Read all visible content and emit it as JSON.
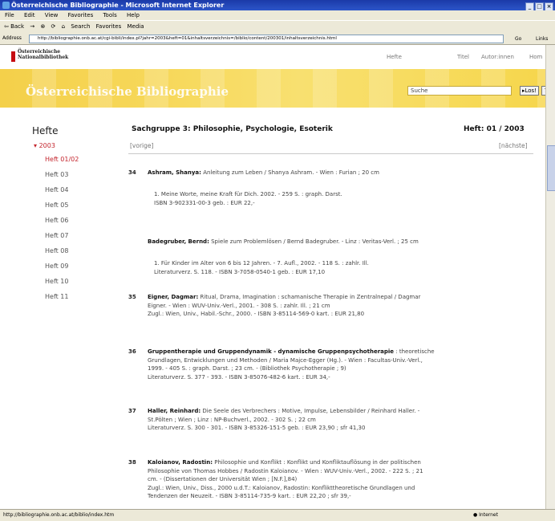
{
  "window": {
    "title": "Österreichische Bibliographie - Microsoft Internet Explorer",
    "controls": [
      "_",
      "□",
      "×"
    ]
  },
  "menu": [
    "File",
    "Edit",
    "View",
    "Favorites",
    "Tools",
    "Help"
  ],
  "toolbar": {
    "back": "⇦ Back",
    "forward": "→",
    "search": "Search",
    "favorites": "Favorites",
    "media": "Media"
  },
  "address": {
    "label": "Address",
    "url": "http://bibliographie.onb.ac.at/cgi-bibli/index.pl?jahr=2003&heft=01&inhaltsverzeichnis=/biblio/content/200301/inhaltsverzeichnis.html",
    "go": "Go",
    "links": "Links"
  },
  "site": {
    "logo_line1": "Österreichische",
    "logo_line2": "Nationalbibliothek",
    "nav": [
      "Hefte",
      "Titel",
      "Autor:innen",
      "Hom"
    ],
    "banner_title": "Österreichische Bibliographie",
    "search_value": "Suche",
    "search_button": "Los!",
    "help_button": "?"
  },
  "sidebar": {
    "title": "Hefte",
    "year": "2003",
    "items": [
      "Heft 01/02",
      "Heft 03",
      "Heft 04",
      "Heft 05",
      "Heft 06",
      "Heft 07",
      "Heft 08",
      "Heft 09",
      "Heft 10",
      "Heft 11"
    ],
    "active": "Heft 01/02"
  },
  "content": {
    "heading": "Sachgruppe 3: Philosophie, Psychologie, Esoterik",
    "heft": "Heft: 01 / 2003",
    "prev": "[vorige]",
    "next": "[nächste]",
    "entries": [
      {
        "num": "34",
        "author": "Ashram, Shanya:",
        "text": "Anleitung zum Leben / Shanya Ashram. - Wien : Furian ; 20 cm"
      },
      {
        "sub": "1. Meine Worte, meine Kraft für Dich. 2002. - 259 S. : graph. Darst.",
        "sub2": "ISBN 3-902331-00-3 geb. : EUR 22,-"
      },
      {
        "author": "Badegruber, Bernd:",
        "text": "Spiele zum Problemlösen / Bernd Badegruber. - Linz : Veritas-Verl. ; 25 cm"
      },
      {
        "sub": "1. Für Kinder im Alter von 6 bis 12 Jahren. - 7. Aufl., 2002. - 118 S. : zahlr. Ill.",
        "sub2": "Literaturverz. S. 118. - ISBN 3-7058-0540-1 geb. : EUR 17,10"
      },
      {
        "num": "35",
        "author": "Eigner, Dagmar:",
        "line1": "Ritual, Drama, Imagination : schamanische Therapie in Zentralnepal / Dagmar",
        "line2": "Eigner. - Wien : WUV-Univ.-Verl., 2001. - 308 S. : zahlr. Ill. ; 21 cm",
        "line3": "Zugl.: Wien, Univ., Habil.-Schr., 2000. - ISBN 3-85114-569-0 kart. : EUR 21,80"
      },
      {
        "num": "36",
        "author": "Gruppentherapie und Gruppendynamik - dynamische Gruppenpsychotherapie",
        "line1a": ": theoretische",
        "line2": "Grundlagen, Entwicklungen und Methoden / Maria Majce-Egger (Hg.). - Wien : Facultas-Univ.-Verl.,",
        "line3": "1999. - 405 S. : graph. Darst. ; 23 cm. - (Bibliothek Psychotherapie ; 9)",
        "line4": "Literaturverz. S. 377 - 393. - ISBN 3-85076-482-6 kart. : EUR 34,-"
      },
      {
        "num": "37",
        "author": "Haller, Reinhard:",
        "line1": "Die Seele des Verbrechers : Motive, Impulse, Lebensbilder / Reinhard Haller. -",
        "line2": "St.Pölten ; Wien ; Linz : NP-Buchverl., 2002. - 302 S. ; 22 cm",
        "line3": "Literaturverz. S. 300 - 301. - ISBN 3-85326-151-5 geb. : EUR 23,90 ; sfr 41,30"
      },
      {
        "num": "38",
        "author": "Kaloianov, Radostin:",
        "line1": "Philosophie und Konflikt : Konflikt und Konfliktauflösung in der politischen",
        "line2": "Philosophie von Thomas Hobbes / Radostin Kaloianov. - Wien : WUV-Univ.-Verl., 2002. - 222 S. ; 21",
        "line3": "cm. - (Dissertationen der Universität Wien ; [N.F.],84)",
        "line4": "Zugl.: Wien, Univ., Diss., 2000 u.d.T.: Kaloianov, Radostin: Konflikttheoretische Grundlagen und",
        "line5": "Tendenzen der Neuzeit. - ISBN 3-85114-735-9 kart. : EUR 22,20 ; sfr 39,-"
      }
    ]
  },
  "status": {
    "text": "http://bibliographie.onb.ac.at/biblio/index.htm",
    "zone": "Internet"
  }
}
